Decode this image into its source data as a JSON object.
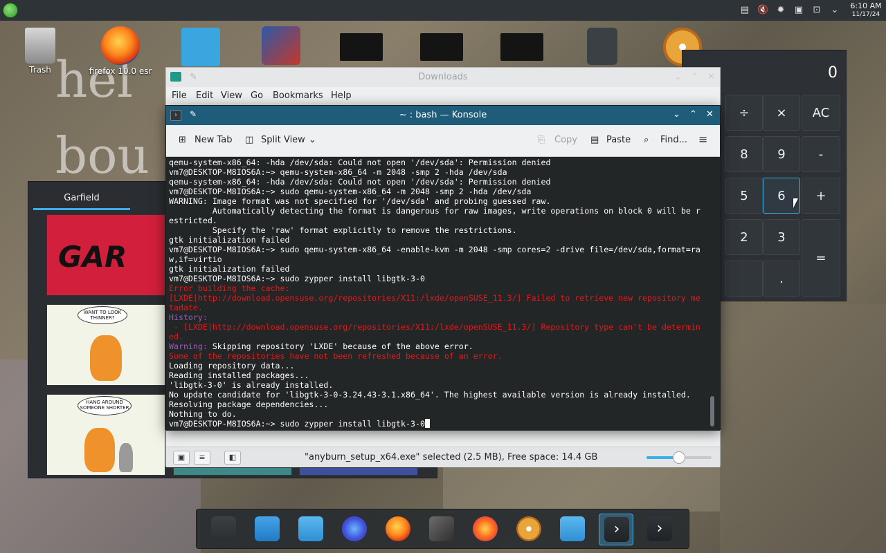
{
  "top_panel": {
    "clock_time": "6:10 AM",
    "clock_date": "11/17/24",
    "tray_icons": [
      "clipboard-icon",
      "volume-muted-icon",
      "brightness-icon",
      "save-icon",
      "network-icon",
      "chevron-down-icon"
    ]
  },
  "desktop": {
    "icons": [
      {
        "label": "Trash"
      },
      {
        "label": "firefox 10.0 esr"
      }
    ]
  },
  "calculator": {
    "display": "0",
    "buttons": [
      "÷",
      "×",
      "AC",
      "8",
      "9",
      "-",
      "5",
      "6",
      "+",
      "2",
      "3",
      "=",
      "."
    ]
  },
  "garfield": {
    "tab_label": "Garfield",
    "panel_2_text": "WANT TO LOOK THINNER?",
    "panel_3_text": "HANG AROUND SOMEONE SHORTER"
  },
  "file_manager": {
    "title": "Downloads",
    "menu": [
      "File",
      "Edit",
      "View",
      "Go",
      "Bookmarks",
      "Help"
    ],
    "status_text": "\"anyburn_setup_x64.exe\" selected (2.5 MB), Free space: 14.4 GB",
    "zoom_level": 0.5
  },
  "konsole": {
    "title": "~ : bash — Konsole",
    "toolbar": {
      "new_tab": "New Tab",
      "split_view": "Split View",
      "copy": "Copy",
      "paste": "Paste",
      "find": "Find..."
    },
    "lines": [
      {
        "c": "n",
        "t": "qemu-system-x86_64: -hda /dev/sda: Could not open '/dev/sda': Permission denied"
      },
      {
        "c": "n",
        "t": "vm7@DESKTOP-M8IOS6A:~> qemu-system-x86_64 -m 2048 -smp 2 -hda /dev/sda"
      },
      {
        "c": "n",
        "t": "qemu-system-x86_64: -hda /dev/sda: Could not open '/dev/sda': Permission denied"
      },
      {
        "c": "n",
        "t": "vm7@DESKTOP-M8IOS6A:~> sudo qemu-system-x86_64 -m 2048 -smp 2 -hda /dev/sda"
      },
      {
        "c": "n",
        "t": "WARNING: Image format was not specified for '/dev/sda' and probing guessed raw."
      },
      {
        "c": "n",
        "t": "         Automatically detecting the format is dangerous for raw images, write operations on block 0 will be r"
      },
      {
        "c": "n",
        "t": "estricted."
      },
      {
        "c": "n",
        "t": "         Specify the 'raw' format explicitly to remove the restrictions."
      },
      {
        "c": "n",
        "t": "gtk initialization failed"
      },
      {
        "c": "n",
        "t": "vm7@DESKTOP-M8IOS6A:~> sudo qemu-system-x86_64 -enable-kvm -m 2048 -smp cores=2 -drive file=/dev/sda,format=ra"
      },
      {
        "c": "n",
        "t": "w,if=virtio"
      },
      {
        "c": "n",
        "t": "gtk initialization failed"
      },
      {
        "c": "n",
        "t": "vm7@DESKTOP-M8IOS6A:~> sudo zypper install libgtk-3-0"
      },
      {
        "c": "red",
        "t": "Error building the cache:"
      },
      {
        "c": "red",
        "t": "[LXDE|http://download.opensuse.org/repositories/X11:/lxde/openSUSE_11.3/] Failed to retrieve new repository me"
      },
      {
        "c": "red",
        "t": "tadate."
      },
      {
        "c": "pur",
        "t": "History:"
      },
      {
        "c": "red",
        "t": " - [LXDE|http://download.opensuse.org/repositories/X11:/lxde/openSUSE_11.3/] Repository type can't be determin"
      },
      {
        "c": "red",
        "t": "ed."
      },
      {
        "c": "warn",
        "label": "Warning:",
        "t": " Skipping repository 'LXDE' because of the above error."
      },
      {
        "c": "red",
        "t": "Some of the repositories have not been refreshed because of an error."
      },
      {
        "c": "n",
        "t": "Loading repository data..."
      },
      {
        "c": "n",
        "t": "Reading installed packages..."
      },
      {
        "c": "n",
        "t": "'libgtk-3-0' is already installed."
      },
      {
        "c": "n",
        "t": "No update candidate for 'libgtk-3-0-3.24.43-3.1.x86_64'. The highest available version is already installed."
      },
      {
        "c": "n",
        "t": "Resolving package dependencies..."
      },
      {
        "c": "n",
        "t": "Nothing to do."
      }
    ],
    "prompt_line": "vm7@DESKTOP-M8IOS6A:~> sudo zypper install libgtk-3-0"
  },
  "dock": {
    "items": [
      "settings-icon",
      "store-icon",
      "folder-icon",
      "firefox-dev-icon",
      "firefox-icon",
      "editor-icon",
      "firefox-nightly-icon",
      "disc-burner-icon",
      "file-manager-icon",
      "konsole-icon",
      "terminal-icon"
    ],
    "active_index": 9
  },
  "colors": {
    "accent": "#3daee9",
    "terminal_bg": "#232627",
    "error_red": "#ed1515",
    "history_purple": "#9b59b6"
  }
}
